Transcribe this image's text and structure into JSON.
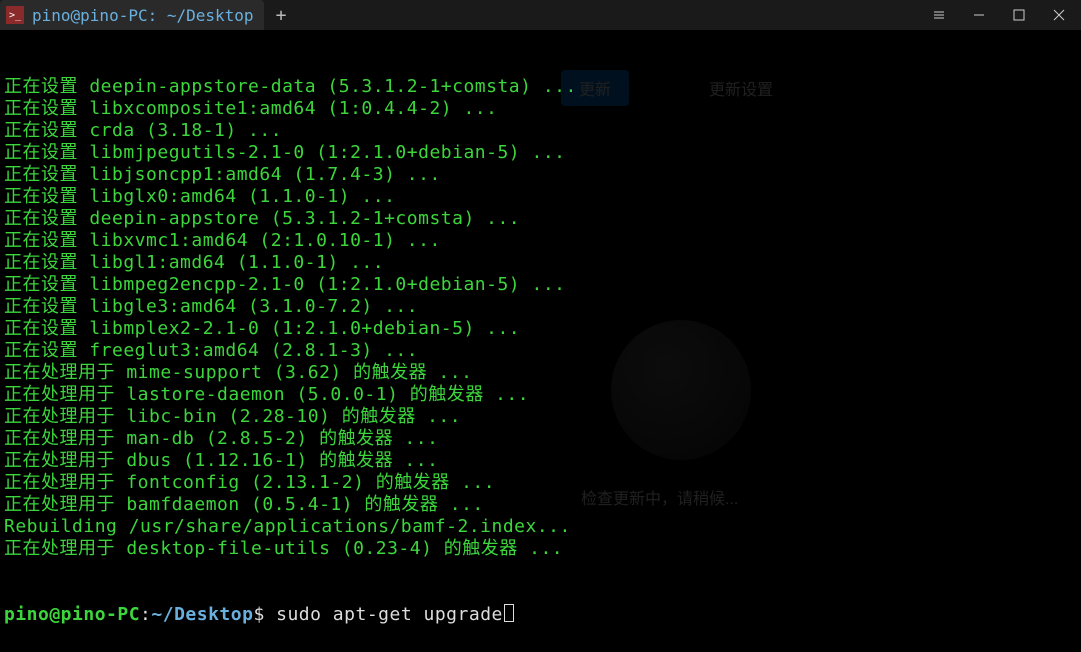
{
  "tab": {
    "title": "pino@pino-PC: ~/Desktop"
  },
  "lines": [
    "正在设置 deepin-appstore-data (5.3.1.2-1+comsta) ...",
    "正在设置 libxcomposite1:amd64 (1:0.4.4-2) ...",
    "正在设置 crda (3.18-1) ...",
    "正在设置 libmjpegutils-2.1-0 (1:2.1.0+debian-5) ...",
    "正在设置 libjsoncpp1:amd64 (1.7.4-3) ...",
    "正在设置 libglx0:amd64 (1.1.0-1) ...",
    "正在设置 deepin-appstore (5.3.1.2-1+comsta) ...",
    "正在设置 libxvmc1:amd64 (2:1.0.10-1) ...",
    "正在设置 libgl1:amd64 (1.1.0-1) ...",
    "正在设置 libmpeg2encpp-2.1-0 (1:2.1.0+debian-5) ...",
    "正在设置 libgle3:amd64 (3.1.0-7.2) ...",
    "正在设置 libmplex2-2.1-0 (1:2.1.0+debian-5) ...",
    "正在设置 freeglut3:amd64 (2.8.1-3) ...",
    "正在处理用于 mime-support (3.62) 的触发器 ...",
    "正在处理用于 lastore-daemon (5.0.0-1) 的触发器 ...",
    "正在处理用于 libc-bin (2.28-10) 的触发器 ...",
    "正在处理用于 man-db (2.8.5-2) 的触发器 ...",
    "正在处理用于 dbus (1.12.16-1) 的触发器 ...",
    "正在处理用于 fontconfig (2.13.1-2) 的触发器 ...",
    "正在处理用于 bamfdaemon (0.5.4-1) 的触发器 ...",
    "Rebuilding /usr/share/applications/bamf-2.index...",
    "正在处理用于 desktop-file-utils (0.23-4) 的触发器 ..."
  ],
  "prompt": {
    "user": "pino@pino-PC",
    "colon": ":",
    "path": "~/Desktop",
    "dollar": "$ ",
    "cmd": "sudo apt-get upgrade"
  },
  "bg": {
    "btn1": "更新",
    "btn2": "更新设置",
    "status": "检查更新中，请稍候..."
  }
}
